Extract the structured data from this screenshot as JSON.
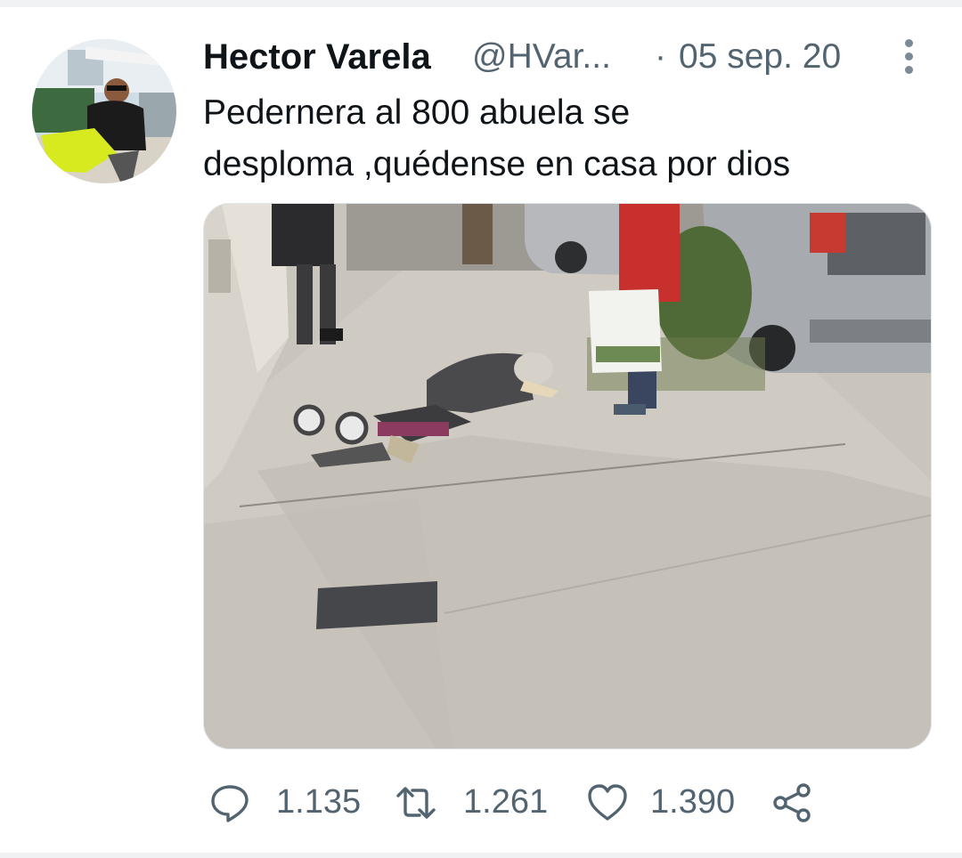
{
  "tweet": {
    "author_name": "Hector Varela",
    "handle": "@HVar...",
    "separator": "·",
    "date": "05 sep. 20",
    "text_line1": "Pedernera al 800 abuela se",
    "text_line2": "desploma ,quédense en casa por dios"
  },
  "actions": {
    "replies": "1.135",
    "retweets": "1.261",
    "likes": "1.390"
  },
  "colors": {
    "text_primary": "#0f1419",
    "text_secondary": "#536471"
  },
  "icons": {
    "reply": "reply-icon",
    "retweet": "retweet-icon",
    "like": "heart-icon",
    "share": "share-icon",
    "more": "more-options-icon"
  }
}
